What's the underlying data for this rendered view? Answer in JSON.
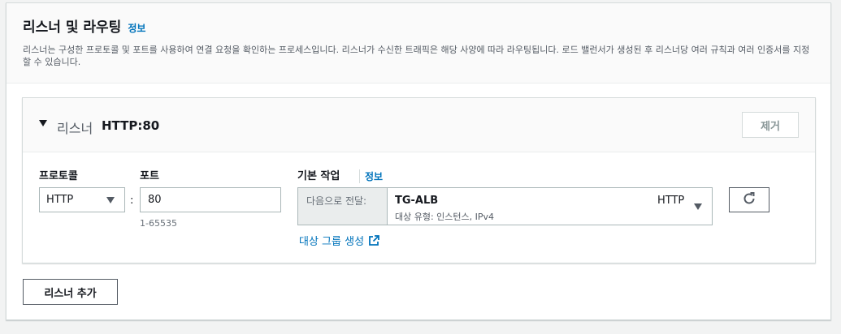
{
  "section": {
    "title": "리스너 및 라우팅",
    "info_label": "정보",
    "description": "리스너는 구성한 프로토콜 및 포트를 사용하여 연결 요청을 확인하는 프로세스입니다. 리스너가 수신한 트래픽은 해당 사양에 따라 라우팅됩니다. 로드 밸런서가 생성된 후 리스너당 여러 규칙과 여러 인증서를 지정할 수 있습니다."
  },
  "listener": {
    "title_prefix": "리스너",
    "title_value": "HTTP:80",
    "remove_label": "제거",
    "protocol_label": "프로토콜",
    "protocol_value": "HTTP",
    "port_label": "포트",
    "port_value": "80",
    "port_hint": "1-65535",
    "colon": ":",
    "default_action_label": "기본 작업",
    "default_action_info": "정보",
    "forward_prefix": "다음으로 전달:",
    "target_group_name": "TG-ALB",
    "target_group_desc": "대상 유형: 인스턴스, IPv4",
    "target_group_protocol": "HTTP",
    "create_target_group_label": "대상 그룹 생성"
  },
  "add_listener_label": "리스너 추가",
  "icons": {
    "toggle": "caret-down-icon",
    "dropdown": "caret-down-icon",
    "external": "external-link-icon",
    "refresh": "refresh-icon"
  },
  "colors": {
    "link": "#0073bb",
    "text": "#16191f",
    "muted": "#545b64",
    "border": "#aab7b8"
  }
}
